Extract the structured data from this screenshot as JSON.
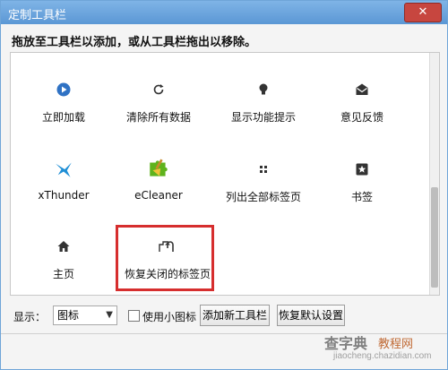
{
  "window": {
    "title": "定制工具栏",
    "close_symbol": "✕"
  },
  "instructions": "拖放至工具栏以添加，或从工具栏拖出以移除。",
  "items": [
    {
      "label": "立即加载",
      "icon": "play-icon"
    },
    {
      "label": "清除所有数据",
      "icon": "refresh-icon"
    },
    {
      "label": "显示功能提示",
      "icon": "lightbulb-icon"
    },
    {
      "label": "意见反馈",
      "icon": "envelope-icon"
    },
    {
      "label": "xThunder",
      "icon": "thunder-bird-icon"
    },
    {
      "label": "eCleaner",
      "icon": "broom-puzzle-icon"
    },
    {
      "label": "列出全部标签页",
      "icon": "grid-dots-icon"
    },
    {
      "label": "书签",
      "icon": "star-icon"
    },
    {
      "label": "主页",
      "icon": "home-icon"
    },
    {
      "label": "恢复关闭的标签页",
      "icon": "restore-tab-icon"
    }
  ],
  "bottom": {
    "display_label": "显示：",
    "display_value": "图标",
    "small_icons_label": "使用小图标",
    "add_toolbar_label": "添加新工具栏",
    "restore_default_label": "恢复默认设置"
  },
  "watermark": {
    "line1": "查字典",
    "line2": "教程网",
    "line3": "jiaocheng.chazidian.com"
  },
  "colors": {
    "accent": "#3b78c8",
    "highlight": "#d62e2e"
  }
}
